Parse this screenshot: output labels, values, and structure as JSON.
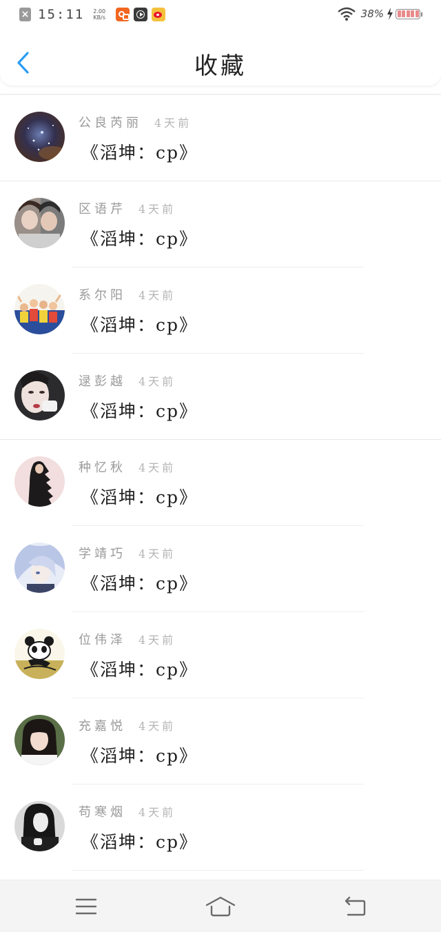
{
  "status_bar": {
    "time": "15:11",
    "speed_value": "2.00",
    "speed_unit": "KB/s",
    "battery_percent": "38%",
    "app_icons": [
      "kuaishou-icon",
      "video-player-icon",
      "weibo-icon"
    ]
  },
  "header": {
    "title": "收藏",
    "back_icon": "chevron-left-icon",
    "accent_color": "#2a9df4"
  },
  "items": [
    {
      "name": "公良芮丽",
      "time": "4天前",
      "title": "《滔坤：cp》",
      "avatar": "galaxy"
    },
    {
      "name": "区语芹",
      "time": "4天前",
      "title": "《滔坤：cp》",
      "avatar": "two-girls"
    },
    {
      "name": "系尔阳",
      "time": "4天前",
      "title": "《滔坤：cp》",
      "avatar": "group"
    },
    {
      "name": "逯彭越",
      "time": "4天前",
      "title": "《滔坤：cp》",
      "avatar": "face-mask"
    },
    {
      "name": "种忆秋",
      "time": "4天前",
      "title": "《滔坤：cp》",
      "avatar": "dark-figure"
    },
    {
      "name": "学靖巧",
      "time": "4天前",
      "title": "《滔坤：cp》",
      "avatar": "anime"
    },
    {
      "name": "位伟泽",
      "time": "4天前",
      "title": "《滔坤：cp》",
      "avatar": "panda"
    },
    {
      "name": "充嘉悦",
      "time": "4天前",
      "title": "《滔坤：cp》",
      "avatar": "girl-portrait"
    },
    {
      "name": "苟寒烟",
      "time": "4天前",
      "title": "《滔坤：cp》",
      "avatar": "bw-portrait"
    }
  ],
  "nav_bar": {
    "icons": [
      "menu-icon",
      "home-icon",
      "back-icon"
    ]
  }
}
